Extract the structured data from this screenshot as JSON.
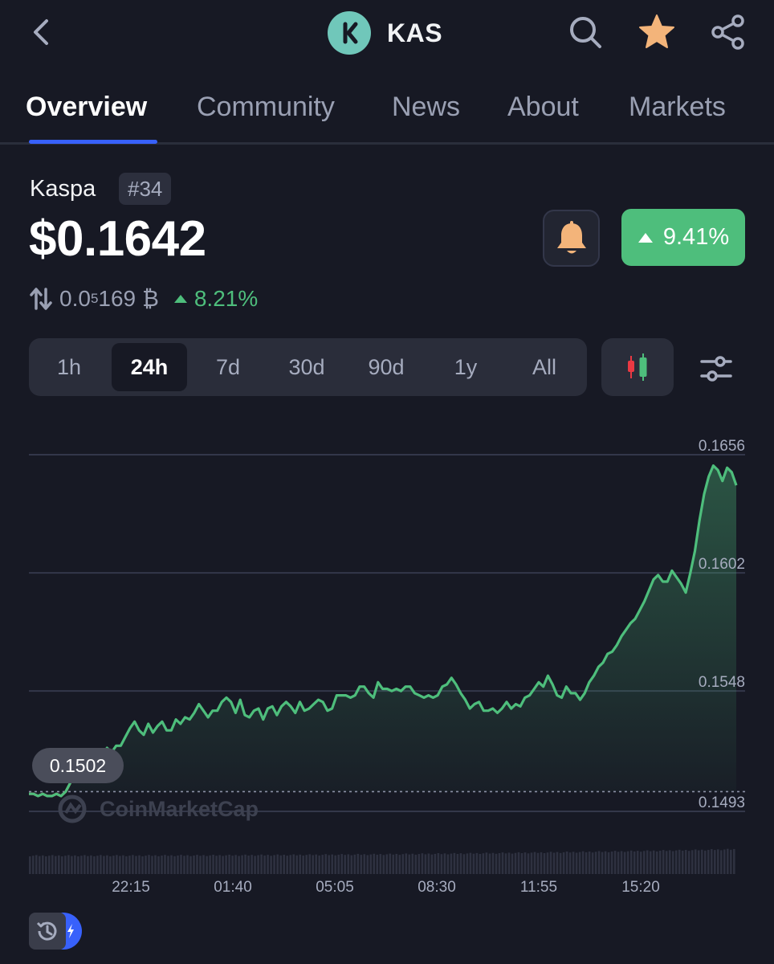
{
  "header": {
    "symbol": "KAS",
    "brand_color": "#70c7ba",
    "icons": [
      "back-icon",
      "search-icon",
      "star-icon",
      "share-icon"
    ],
    "favorite_color": "#f3b47a"
  },
  "tabs": [
    {
      "label": "Overview",
      "active": true
    },
    {
      "label": "Community",
      "active": false
    },
    {
      "label": "News",
      "active": false
    },
    {
      "label": "About",
      "active": false
    },
    {
      "label": "Markets",
      "active": false
    }
  ],
  "coin": {
    "name": "Kaspa",
    "rank": "#34",
    "price": "$0.1642",
    "change_24h": "9.41%",
    "btc_price_prefix": "0.0",
    "btc_price_sub": "5",
    "btc_price_rest": "169",
    "btc_symbol": "₿",
    "btc_change": "8.21%",
    "positive_color": "#4ebe7c",
    "negative_color": "#ea3943"
  },
  "ranges": [
    {
      "label": "1h",
      "active": false
    },
    {
      "label": "24h",
      "active": true
    },
    {
      "label": "7d",
      "active": false
    },
    {
      "label": "30d",
      "active": false
    },
    {
      "label": "90d",
      "active": false
    },
    {
      "label": "1y",
      "active": false
    },
    {
      "label": "All",
      "active": false
    }
  ],
  "chart_data": {
    "type": "line",
    "y_ticks": [
      "0.1656",
      "0.1602",
      "0.1548",
      "0.1493"
    ],
    "ylim": [
      0.1493,
      0.1656
    ],
    "x_ticks": [
      "22:15",
      "01:40",
      "05:05",
      "08:30",
      "11:55",
      "15:20"
    ],
    "reference_line": 0.1502,
    "start_label": "0.1502",
    "watermark": "CoinMarketCap",
    "grid": true,
    "series": [
      {
        "values": [
          0.1501,
          0.1501,
          0.15,
          0.1501,
          0.15,
          0.15,
          0.1501,
          0.15,
          0.1502,
          0.1506,
          0.1509,
          0.151,
          0.1513,
          0.1517,
          0.1518,
          0.1515,
          0.1519,
          0.1522,
          0.152,
          0.1523,
          0.1523,
          0.1527,
          0.1531,
          0.1534,
          0.153,
          0.1528,
          0.1533,
          0.1529,
          0.1532,
          0.1534,
          0.153,
          0.153,
          0.1535,
          0.1533,
          0.1536,
          0.1535,
          0.1538,
          0.1542,
          0.1539,
          0.1536,
          0.1539,
          0.1539,
          0.1543,
          0.1545,
          0.1543,
          0.1538,
          0.1544,
          0.1537,
          0.1536,
          0.1539,
          0.154,
          0.1535,
          0.154,
          0.1541,
          0.1537,
          0.1541,
          0.1543,
          0.1541,
          0.1538,
          0.1543,
          0.1539,
          0.154,
          0.1542,
          0.1544,
          0.1543,
          0.1539,
          0.154,
          0.1546,
          0.1546,
          0.1546,
          0.1545,
          0.1546,
          0.155,
          0.155,
          0.1547,
          0.1545,
          0.1552,
          0.1549,
          0.1549,
          0.1548,
          0.1549,
          0.1548,
          0.155,
          0.155,
          0.1547,
          0.1546,
          0.1545,
          0.1546,
          0.1545,
          0.1546,
          0.155,
          0.1551,
          0.1554,
          0.1551,
          0.1547,
          0.1544,
          0.154,
          0.1542,
          0.1543,
          0.1539,
          0.1539,
          0.154,
          0.1538,
          0.154,
          0.1543,
          0.154,
          0.1542,
          0.1541,
          0.1545,
          0.1546,
          0.1549,
          0.1552,
          0.155,
          0.1555,
          0.1551,
          0.1546,
          0.1545,
          0.155,
          0.1547,
          0.1547,
          0.1544,
          0.1547,
          0.1552,
          0.1555,
          0.1559,
          0.1561,
          0.1565,
          0.1566,
          0.1569,
          0.1573,
          0.1576,
          0.1579,
          0.1581,
          0.1585,
          0.1589,
          0.1594,
          0.1599,
          0.1601,
          0.1598,
          0.1598,
          0.1603,
          0.16,
          0.1597,
          0.1593,
          0.1602,
          0.1612,
          0.1626,
          0.1638,
          0.1646,
          0.1651,
          0.1649,
          0.1644,
          0.165,
          0.1648,
          0.1642
        ]
      }
    ]
  }
}
